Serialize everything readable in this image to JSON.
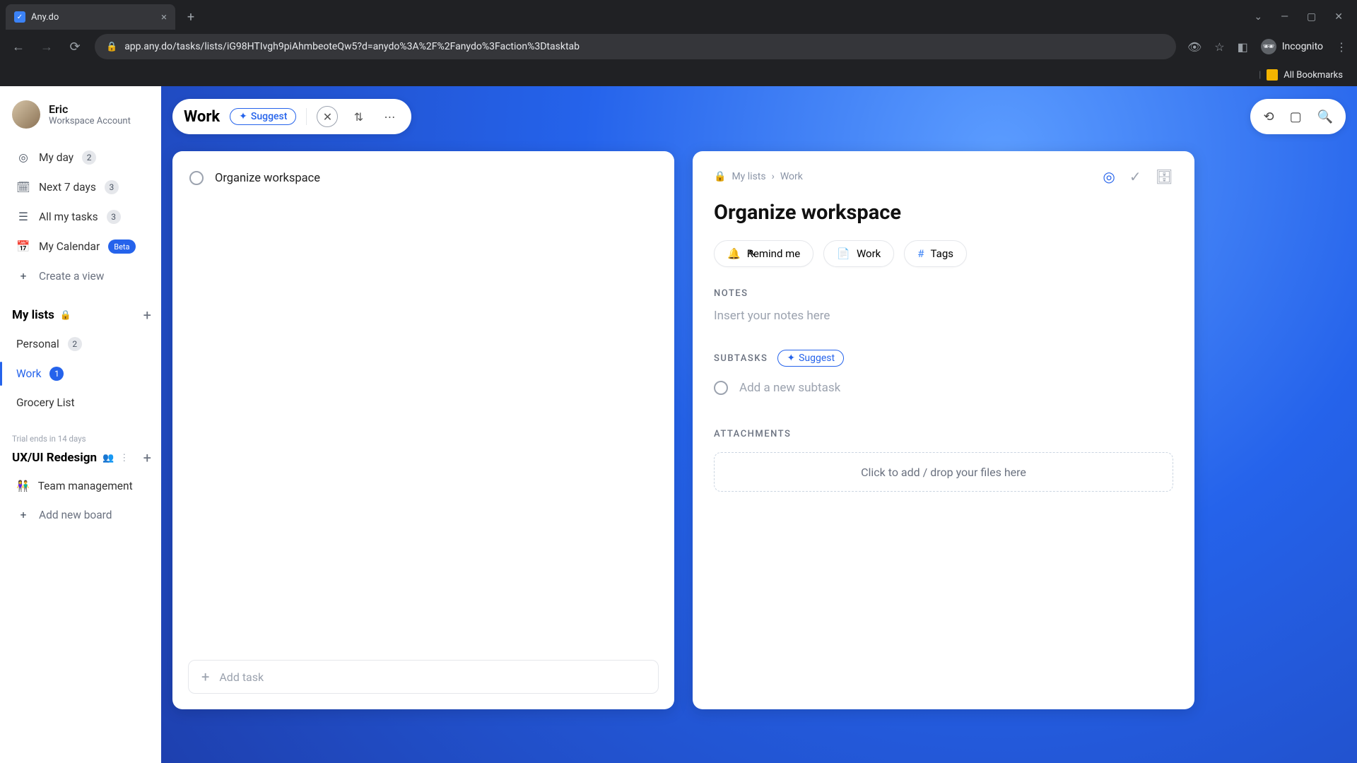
{
  "browser": {
    "tab_title": "Any.do",
    "url": "app.any.do/tasks/lists/iG98HTIvgh9piAhmbeoteQw5?d=anydo%3A%2F%2Fanydo%3Faction%3Dtasktab",
    "incognito_label": "Incognito",
    "bookmarks_label": "All Bookmarks"
  },
  "profile": {
    "name": "Eric",
    "subtitle": "Workspace Account"
  },
  "nav": {
    "my_day": "My day",
    "my_day_count": "2",
    "next7": "Next 7 days",
    "next7_count": "3",
    "all_tasks": "All my tasks",
    "all_tasks_count": "3",
    "calendar": "My Calendar",
    "calendar_badge": "Beta",
    "create_view": "Create a view"
  },
  "lists": {
    "header": "My lists",
    "personal": "Personal",
    "personal_count": "2",
    "work": "Work",
    "work_count": "1",
    "grocery": "Grocery List"
  },
  "workspace": {
    "trial": "Trial ends in 14 days",
    "name": "UX/UI Redesign",
    "board1": "Team management",
    "add_board": "Add new board"
  },
  "header": {
    "title": "Work",
    "suggest": "Suggest"
  },
  "task_list": {
    "item1": "Organize workspace",
    "add_placeholder": "Add task"
  },
  "detail": {
    "crumb_root": "My lists",
    "crumb_leaf": "Work",
    "title": "Organize workspace",
    "chip_remind": "Remind me",
    "chip_list": "Work",
    "chip_tags": "Tags",
    "notes_label": "NOTES",
    "notes_placeholder": "Insert your notes here",
    "subtasks_label": "SUBTASKS",
    "subtasks_suggest": "Suggest",
    "subtask_placeholder": "Add a new subtask",
    "attachments_label": "ATTACHMENTS",
    "attachments_placeholder": "Click to add / drop your files here"
  }
}
